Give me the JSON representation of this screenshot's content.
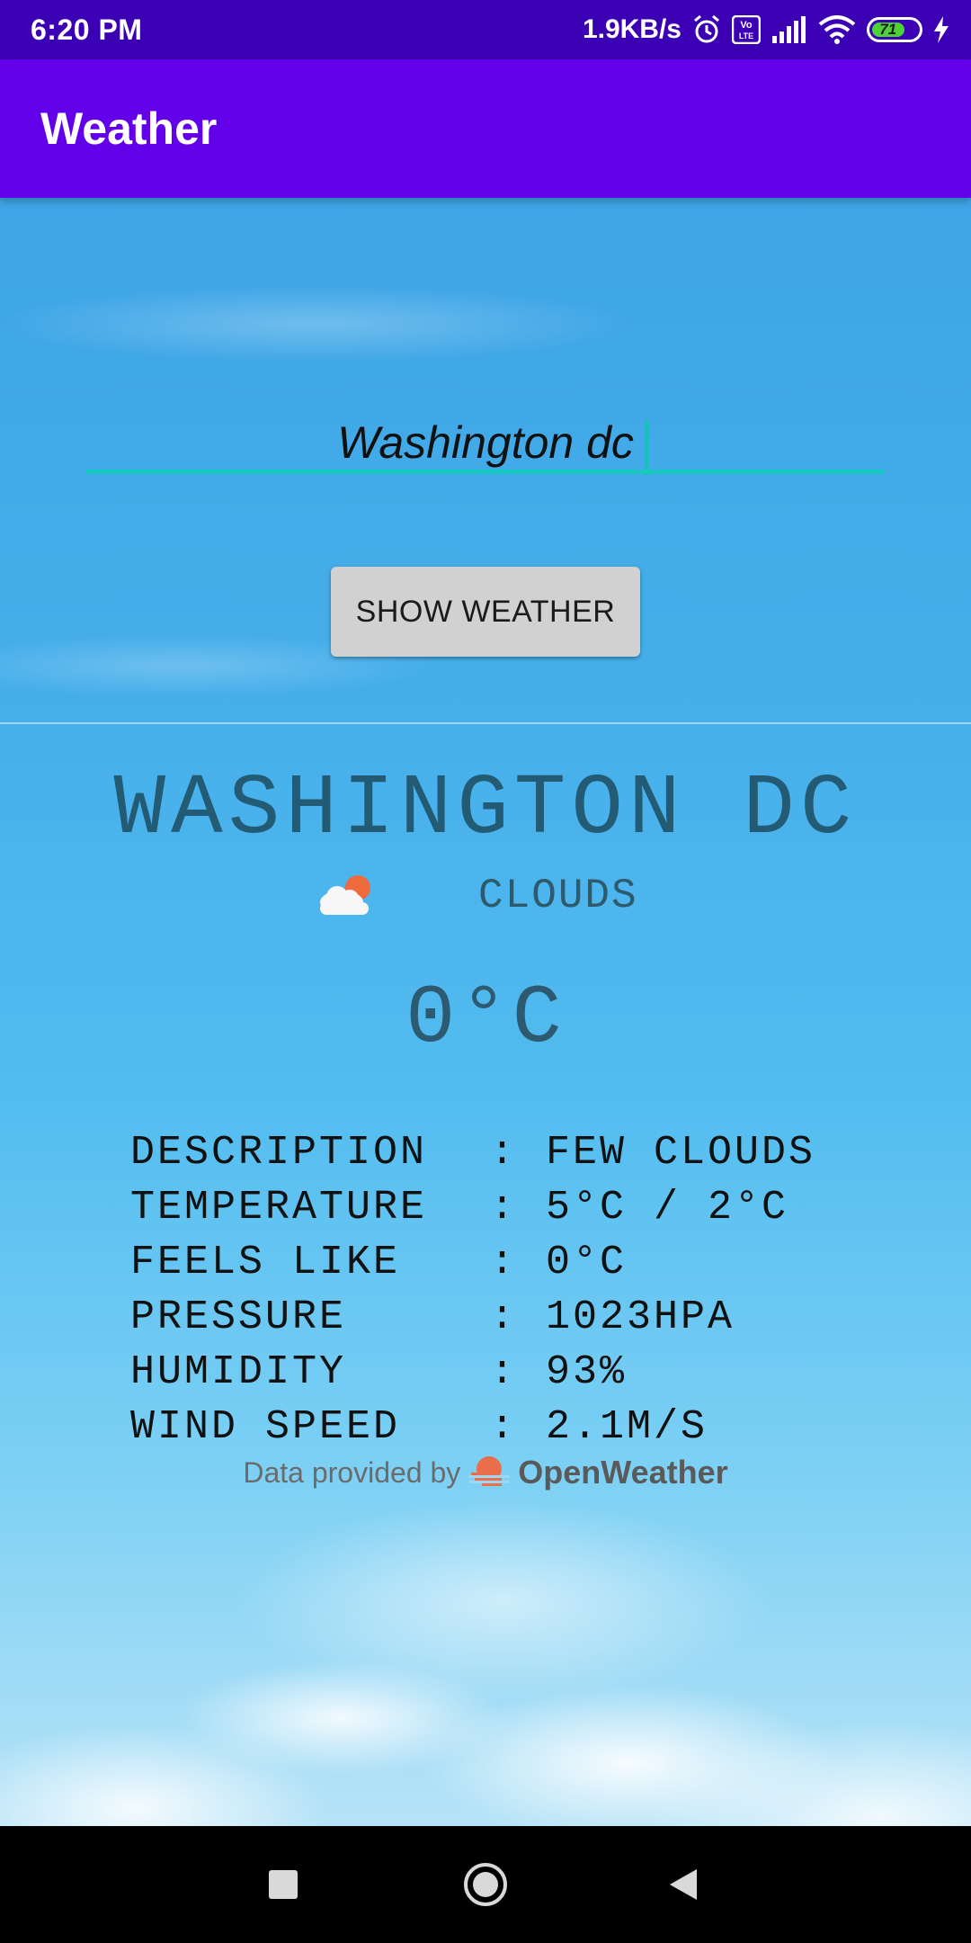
{
  "status_bar": {
    "time": "6:20 PM",
    "net_speed": "1.9KB/s",
    "battery": "71",
    "icons": [
      "alarm-icon",
      "volte-icon",
      "signal-icon",
      "wifi-icon",
      "battery-icon",
      "charging-icon"
    ]
  },
  "app_bar": {
    "title": "Weather"
  },
  "search": {
    "value": "Washington dc"
  },
  "show_button": {
    "label": "SHOW WEATHER"
  },
  "weather": {
    "city": "WASHINGTON DC",
    "condition": "CLOUDS",
    "condition_icon": "partly-cloudy-icon",
    "temperature": "0°C",
    "details": [
      {
        "label": "DESCRIPTION",
        "value": "FEW CLOUDS"
      },
      {
        "label": "TEMPERATURE",
        "value": "5°C / 2°C"
      },
      {
        "label": "FEELS LIKE",
        "value": "0°C"
      },
      {
        "label": "PRESSURE",
        "value": "1023HPA"
      },
      {
        "label": "HUMIDITY",
        "value": "93%"
      },
      {
        "label": "WIND SPEED",
        "value": "2.1M/S"
      }
    ],
    "separator": ":"
  },
  "attribution": {
    "prefix": "Data provided by",
    "brand": "OpenWeather"
  },
  "colors": {
    "status_bar": "#3c00b4",
    "app_bar": "#6200ea",
    "accent": "#17c9c0",
    "city_text": "#235b74"
  },
  "nav_bar": {
    "buttons": [
      "recents-square-icon",
      "home-circle-icon",
      "back-triangle-icon"
    ]
  }
}
